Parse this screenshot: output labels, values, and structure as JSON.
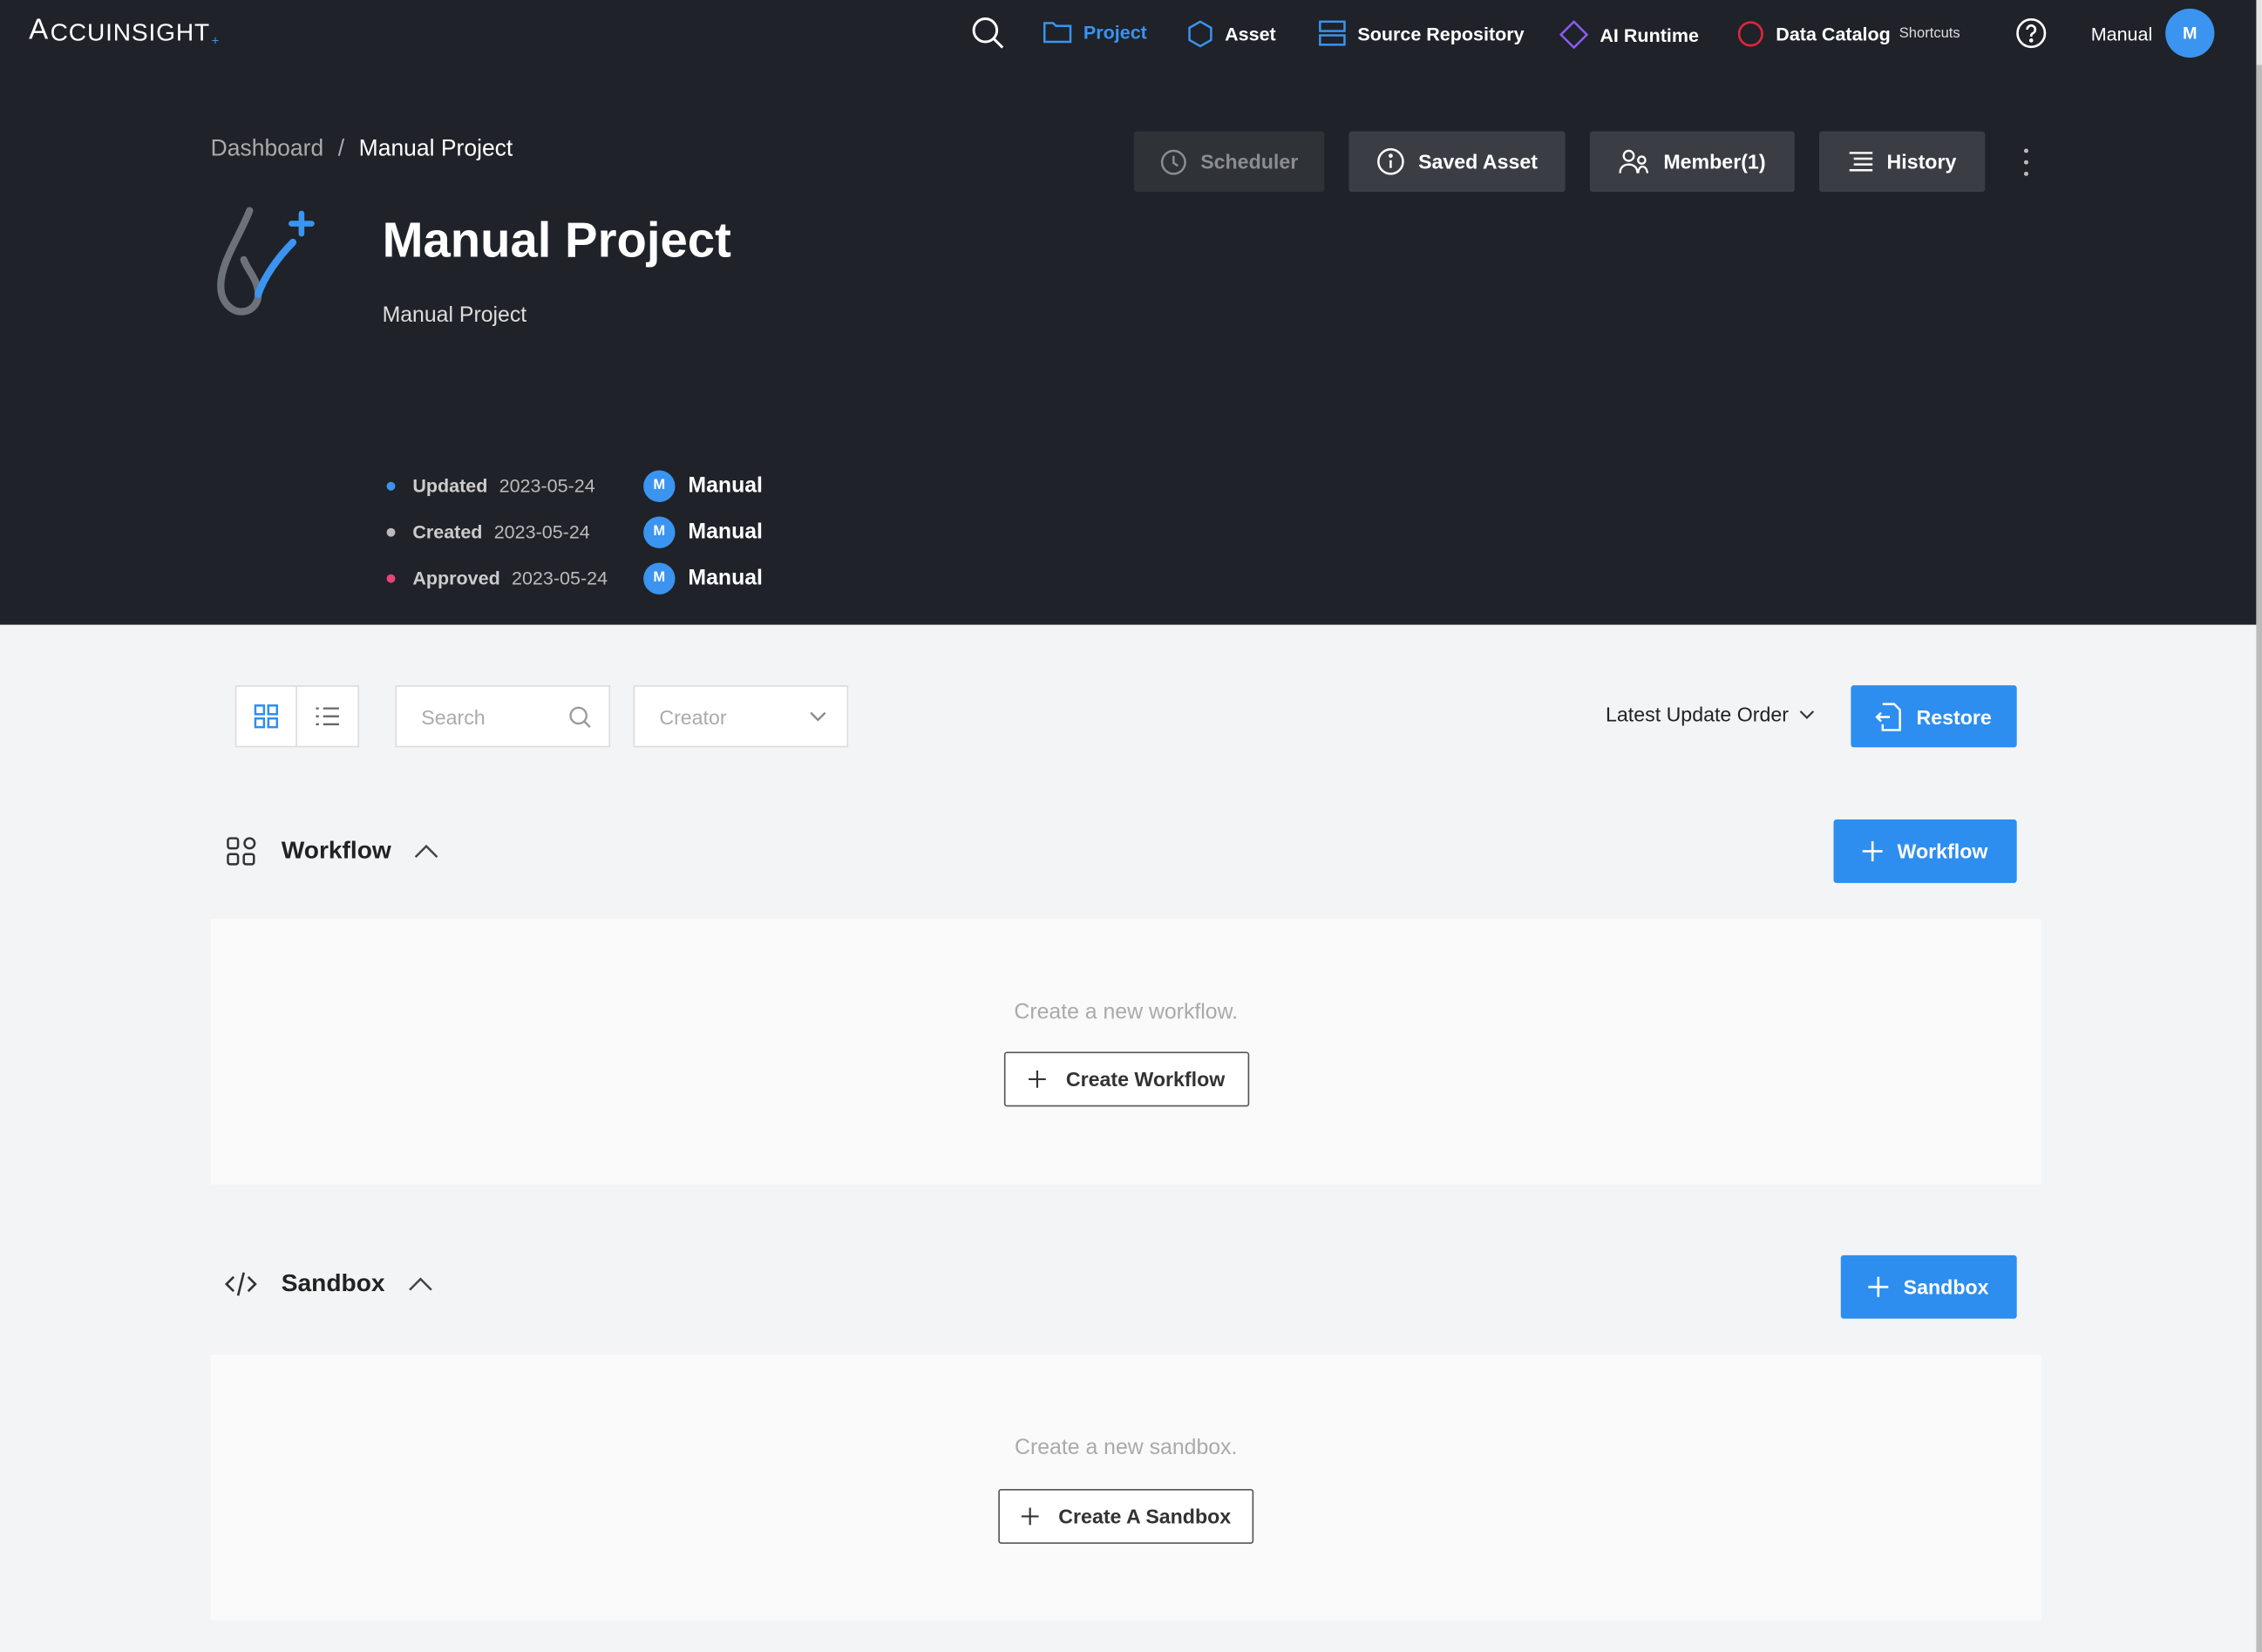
{
  "nav": {
    "logo_text": "CCUINSIGHT",
    "logo_lead": "A",
    "logo_mark": "+",
    "items": [
      {
        "label": "Project",
        "icon": "folder-icon"
      },
      {
        "label": "Asset",
        "icon": "hexagon-icon"
      },
      {
        "label": "Source Repository",
        "icon": "repository-icon"
      },
      {
        "label": "AI Runtime",
        "icon": "diamond-icon"
      },
      {
        "label": "Data Catalog",
        "icon": "circle-icon"
      }
    ],
    "shortcuts": "Shortcuts",
    "user_name": "Manual",
    "user_initial": "M"
  },
  "breadcrumb": {
    "root": "Dashboard",
    "separator": "/",
    "current": "Manual Project"
  },
  "header_buttons": {
    "scheduler": "Scheduler",
    "saved_asset": "Saved Asset",
    "member": "Member(1)",
    "history": "History"
  },
  "project": {
    "title": "Manual Project",
    "description": "Manual Project",
    "meta": [
      {
        "label": "Updated",
        "date": "2023-05-24",
        "initial": "M",
        "user": "Manual",
        "dot_color": "#3a94f0"
      },
      {
        "label": "Created",
        "date": "2023-05-24",
        "initial": "M",
        "user": "Manual",
        "dot_color": "#bbbbbb"
      },
      {
        "label": "Approved",
        "date": "2023-05-24",
        "initial": "M",
        "user": "Manual",
        "dot_color": "#e8457a"
      }
    ]
  },
  "toolbar": {
    "search_placeholder": "Search",
    "creator_placeholder": "Creator",
    "sort_label": "Latest Update Order",
    "restore_label": "Restore"
  },
  "workflow": {
    "title": "Workflow",
    "add_label": "Workflow",
    "empty_message": "Create a new workflow.",
    "create_label": "Create Workflow"
  },
  "sandbox": {
    "title": "Sandbox",
    "add_label": "Sandbox",
    "empty_message": "Create a new sandbox.",
    "create_label": "Create A Sandbox"
  },
  "colors": {
    "accent": "#2d8ef0",
    "header_bg": "#1f2228",
    "page_bg": "#f3f4f6"
  }
}
